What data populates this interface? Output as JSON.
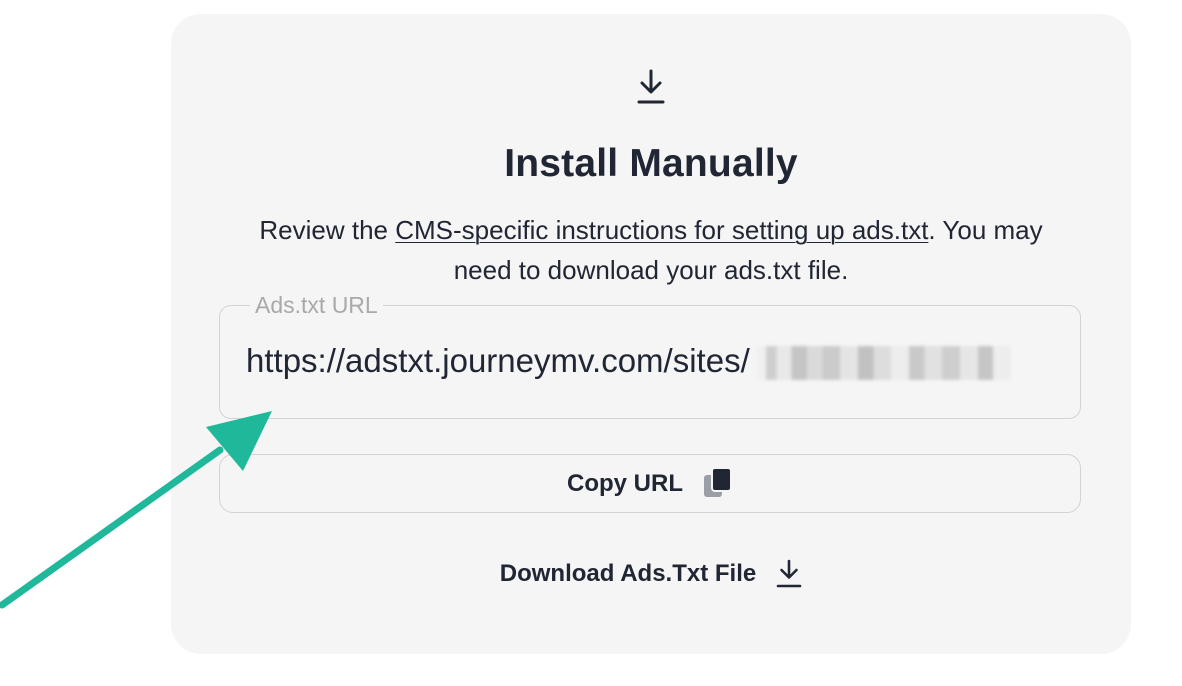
{
  "card": {
    "title": "Install Manually",
    "description": {
      "before_link": "Review the ",
      "link_text": "CMS-specific instructions for setting up ads.txt",
      "after_link": ". You may need to download your ads.txt file."
    },
    "url_field": {
      "label": "Ads.txt URL",
      "value": "https://adstxt.journeymv.com/sites/"
    },
    "copy_button": {
      "label": "Copy URL",
      "icon": "copy-icon"
    },
    "download_link": {
      "label": "Download Ads.Txt File",
      "icon": "download-icon"
    },
    "header_icon": "download-icon"
  },
  "colors": {
    "card_background": "#f5f5f5",
    "text": "#202634",
    "border": "#d3d3d3",
    "label_muted": "#a9a9a9",
    "annotation_arrow": "#1fb89a"
  }
}
